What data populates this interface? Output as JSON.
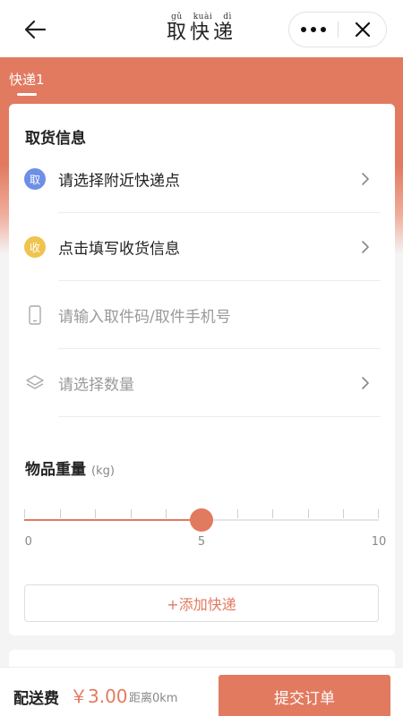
{
  "navbar": {
    "title_pinyin": [
      "gǔ",
      "kuài",
      "dì"
    ],
    "title": "取快递"
  },
  "tabs": [
    {
      "label": "快递1",
      "active": true
    }
  ],
  "pickup": {
    "section_title": "取货信息",
    "rows": [
      {
        "badge": "取",
        "badge_color": "#6e8fe8",
        "text": "请选择附近快递点",
        "placeholder": false,
        "chevron": true
      },
      {
        "badge": "收",
        "badge_color": "#f0c34e",
        "text": "点击填写收货信息",
        "placeholder": false,
        "chevron": true
      },
      {
        "icon": "phone-icon",
        "text": "请输入取件码/取件手机号",
        "placeholder": true,
        "chevron": false
      },
      {
        "icon": "layers-icon",
        "text": "请选择数量",
        "placeholder": true,
        "chevron": true
      }
    ]
  },
  "weight": {
    "title": "物品重量",
    "unit": "(kg)",
    "min": 0,
    "max": 10,
    "value": 5,
    "labels": [
      "0",
      "5",
      "10"
    ]
  },
  "add_button": "+添加快递",
  "footer": {
    "fee_label": "配送费",
    "fee_amount": "￥3.00",
    "distance": "距离0km",
    "submit_label": "提交订单"
  },
  "colors": {
    "accent": "#e27a60",
    "pickup_badge": "#6e8fe8",
    "receive_badge": "#f0c34e"
  }
}
